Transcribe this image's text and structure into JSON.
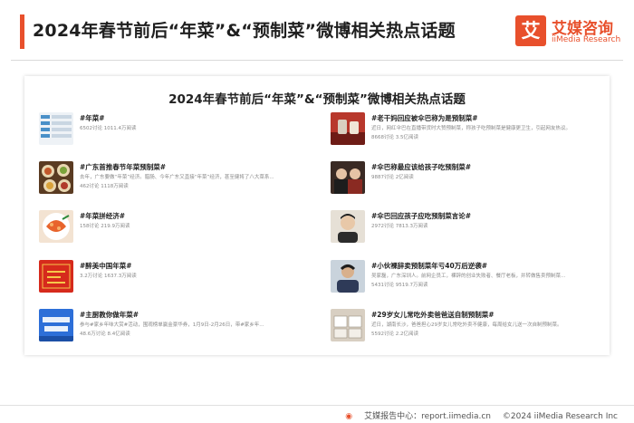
{
  "header": {
    "title": "2024年春节前后“年菜”&“预制菜”微博相关热点话题",
    "logo_mark": "艾",
    "logo_cn": "艾媒咨询",
    "logo_en": "iiMedia Research"
  },
  "panel": {
    "title": "2024年春节前后“年菜”&“预制菜”微博相关热点话题"
  },
  "topics_left": [
    {
      "name": "#年菜#",
      "desc": "",
      "stats": "6502讨论 1011.4万阅读",
      "icon": "screenshot-thumb"
    },
    {
      "name": "#广东首推春节年菜预制菜#",
      "desc": "去年，广东要做“年菜”经济。腊肠、今年广东又直接“年菜”经济，甚至健将了八大菜系...",
      "stats": "462讨论 1118万阅读",
      "icon": "dishes-photo"
    },
    {
      "name": "#年菜拼经济#",
      "desc": "",
      "stats": "158讨论 219.9万阅读",
      "icon": "seafood-photo"
    },
    {
      "name": "#醉美中国年菜#",
      "desc": "",
      "stats": "3.2万讨论 1637.3万阅读",
      "icon": "red-poster"
    },
    {
      "name": "#主厨教你做年菜#",
      "desc": "参与#家乡年味大赏#活动，围观榜单赢金豪华券，1月9日-2月26日，带#家乡年...",
      "stats": "48.6万讨论 8.4亿阅读",
      "icon": "blue-poster"
    }
  ],
  "topics_right": [
    {
      "name": "#老干妈回应被伞巴称为是预制菜#",
      "desc": "近日，网红伞巴在直播带货时大赞预制菜，称孩子吃预制菜是健康更卫生，引起网友热议。",
      "stats": "8668讨论 3.5亿阅读",
      "icon": "product-photo"
    },
    {
      "name": "#伞巴称最应该给孩子吃预制菜#",
      "desc": "",
      "stats": "9887讨论 2亿阅读",
      "icon": "livestream-photo"
    },
    {
      "name": "#伞巴回应孩子应吃预制菜言论#",
      "desc": "",
      "stats": "2972讨论 7813.3万阅读",
      "icon": "portrait-photo"
    },
    {
      "name": "#小伙裸辞卖预制菜年亏40万后逆袭#",
      "desc": "吴家磊，广东深圳人。前网企员工，裸辞的创业失败者、餐厅老板，并转做售卖预制菜...",
      "stats": "5431讨论 9519.7万阅读",
      "icon": "man-photo"
    },
    {
      "name": "#29岁女儿常吃外卖爸爸送自制预制菜#",
      "desc": "近日，湖南长沙，爸爸担心29岁女儿常吃外卖不健康，每周给女儿送一次自制预制菜。",
      "stats": "5592讨论 2.2亿阅读",
      "icon": "box-photo"
    }
  ],
  "footer": {
    "source_icon": "艾媒-icon",
    "source": "艾媒报告中心：report.iimedia.cn",
    "copyright": "©2024  iiMedia Research  Inc"
  },
  "colors": {
    "accent": "#e8502c"
  }
}
